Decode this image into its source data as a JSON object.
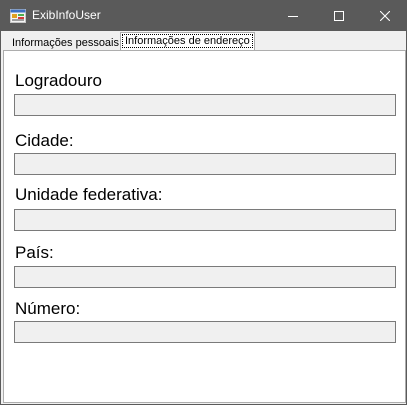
{
  "window": {
    "title": "ExibInfoUser",
    "icon": "app-form-icon"
  },
  "caption_buttons": {
    "minimize_icon": "minimize-icon",
    "maximize_icon": "maximize-icon",
    "close_icon": "close-icon"
  },
  "tabs": [
    {
      "label": "Informações pessoais",
      "selected": false
    },
    {
      "label": "Informações de endereço",
      "selected": true
    }
  ],
  "form": {
    "fields": [
      {
        "label": "Logradouro",
        "value": ""
      },
      {
        "label": "Cidade:",
        "value": ""
      },
      {
        "label": "Unidade federativa:",
        "value": ""
      },
      {
        "label": "País:",
        "value": ""
      },
      {
        "label": "Número:",
        "value": ""
      }
    ]
  },
  "colors": {
    "titlebar": "#5a5a5a",
    "field_background": "#f0f0f0"
  }
}
